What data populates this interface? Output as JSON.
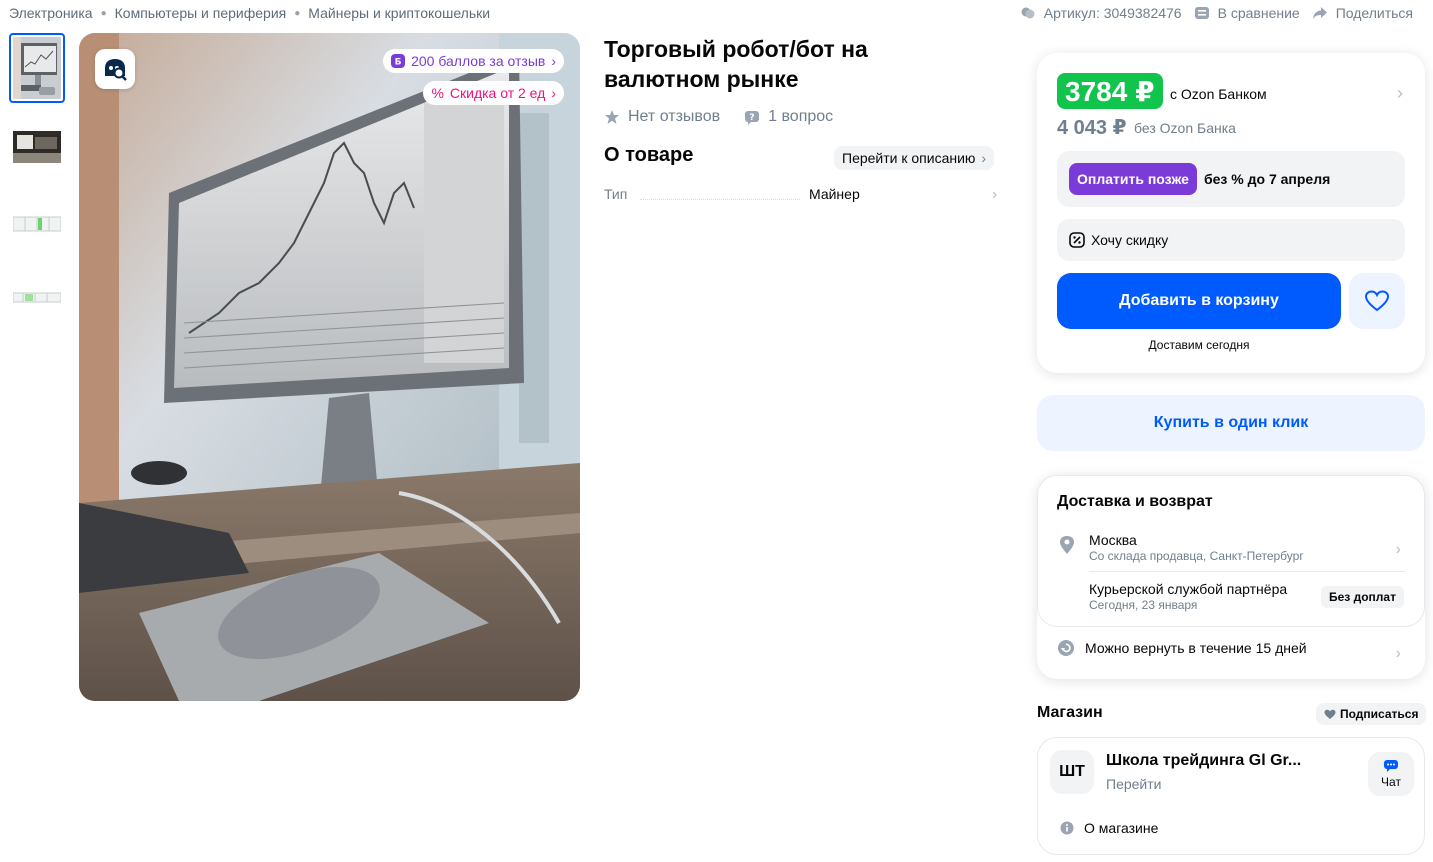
{
  "breadcrumb": {
    "items": [
      "Электроника",
      "Компьютеры и периферия",
      "Майнеры и криптокошельки"
    ]
  },
  "top_actions": {
    "article": "Артикул: 3049382476",
    "compare": "В сравнение",
    "share": "Поделиться"
  },
  "gallery": {
    "badge_reviews": "200 баллов за отзыв",
    "badge_discount": "Скидка от 2 ед"
  },
  "product": {
    "title": "Торговый робот/бот на валютном рынке",
    "reviews": "Нет отзывов",
    "questions": "1 вопрос",
    "about_heading": "О товаре",
    "goto_description": "Перейти к описанию",
    "attributes": [
      {
        "key": "Тип",
        "value": "Майнер"
      }
    ]
  },
  "buy": {
    "price_bank": "3784 ₽",
    "price_bank_note": "с Ozon Банком",
    "price_regular": "4 043 ₽",
    "price_regular_note": "без Ozon Банка",
    "pay_later_button": "Оплатить позже",
    "pay_later_note": "без % до 7 апреля",
    "want_discount": "Хочу скидку",
    "add_to_cart": "Добавить в корзину",
    "delivery_today": "Доставим сегодня",
    "buy_one_click": "Купить в один клик"
  },
  "delivery": {
    "title": "Доставка и возврат",
    "city": "Москва",
    "from": "Со склада продавца, Санкт-Петербург",
    "courier": "Курьерской службой партнёра",
    "date": "Сегодня, 23 января",
    "badge": "Без доплат",
    "return": "Можно вернуть в течение 15 дней"
  },
  "shop": {
    "heading": "Магазин",
    "subscribe": "Подписаться",
    "logo": "ШТ",
    "name": "Школа трейдинга Gl Gr...",
    "go": "Перейти",
    "chat": "Чат",
    "about": "О магазине"
  },
  "colors": {
    "accent_blue": "#005bff",
    "price_green": "#10c44c",
    "pay_later_purple": "#7b3bd9",
    "discount_pink": "#f1117e",
    "muted": "#707f8d"
  },
  "icons": [
    "article-icon",
    "compare-icon",
    "share-icon",
    "image-search-icon",
    "star-icon",
    "question-icon",
    "chevron-right-icon",
    "discount-icon",
    "heart-icon",
    "location-pin-icon",
    "return-icon",
    "heart-small-icon",
    "chat-icon",
    "info-icon"
  ]
}
